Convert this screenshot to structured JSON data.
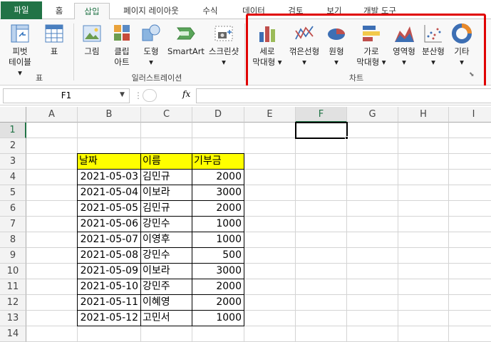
{
  "tabs": [
    {
      "label": "파일"
    },
    {
      "label": "홈"
    },
    {
      "label": "삽입"
    },
    {
      "label": "페이지 레이아웃"
    },
    {
      "label": "수식"
    },
    {
      "label": "데이터"
    },
    {
      "label": "검토"
    },
    {
      "label": "보기"
    },
    {
      "label": "개발 도구"
    }
  ],
  "ribbon": {
    "pivot_label1": "피벗",
    "pivot_label2": "테이블",
    "table_label": "표",
    "group_table": "표",
    "picture_label": "그림",
    "clipart_label1": "클립",
    "clipart_label2": "아트",
    "shapes_label": "도형",
    "smartart_label": "SmartArt",
    "screenshot_label": "스크린샷",
    "group_illustrations": "일러스트레이션",
    "column_label1": "세로",
    "column_label2": "막대형",
    "line_label": "꺾은선형",
    "pie_label": "원형",
    "bar_label1": "가로",
    "bar_label2": "막대형",
    "area_label": "영역형",
    "scatter_label": "분산형",
    "other_label": "기타",
    "group_charts": "차트"
  },
  "formula_bar": {
    "name_box": "F1",
    "fx": "fx",
    "value": ""
  },
  "columns": [
    "A",
    "B",
    "C",
    "D",
    "E",
    "F",
    "G",
    "H",
    "I"
  ],
  "rows": [
    "1",
    "2",
    "3",
    "4",
    "5",
    "6",
    "7",
    "8",
    "9",
    "10",
    "11",
    "12",
    "13",
    "14"
  ],
  "selected_cell": "F1",
  "table": {
    "headers": [
      "날짜",
      "이름",
      "기부금"
    ],
    "rows": [
      [
        "2021-05-03",
        "김민규",
        "2000"
      ],
      [
        "2021-05-04",
        "이보라",
        "3000"
      ],
      [
        "2021-05-05",
        "김민규",
        "2000"
      ],
      [
        "2021-05-06",
        "강민수",
        "1000"
      ],
      [
        "2021-05-07",
        "이영후",
        "1000"
      ],
      [
        "2021-05-08",
        "강민수",
        "500"
      ],
      [
        "2021-05-09",
        "이보라",
        "3000"
      ],
      [
        "2021-05-10",
        "강민주",
        "2000"
      ],
      [
        "2021-05-11",
        "이혜영",
        "2000"
      ],
      [
        "2021-05-12",
        "고민서",
        "1000"
      ]
    ]
  },
  "colors": {
    "accent": "#217346",
    "header_fill": "#ffff00",
    "highlight_box": "#e00000"
  }
}
